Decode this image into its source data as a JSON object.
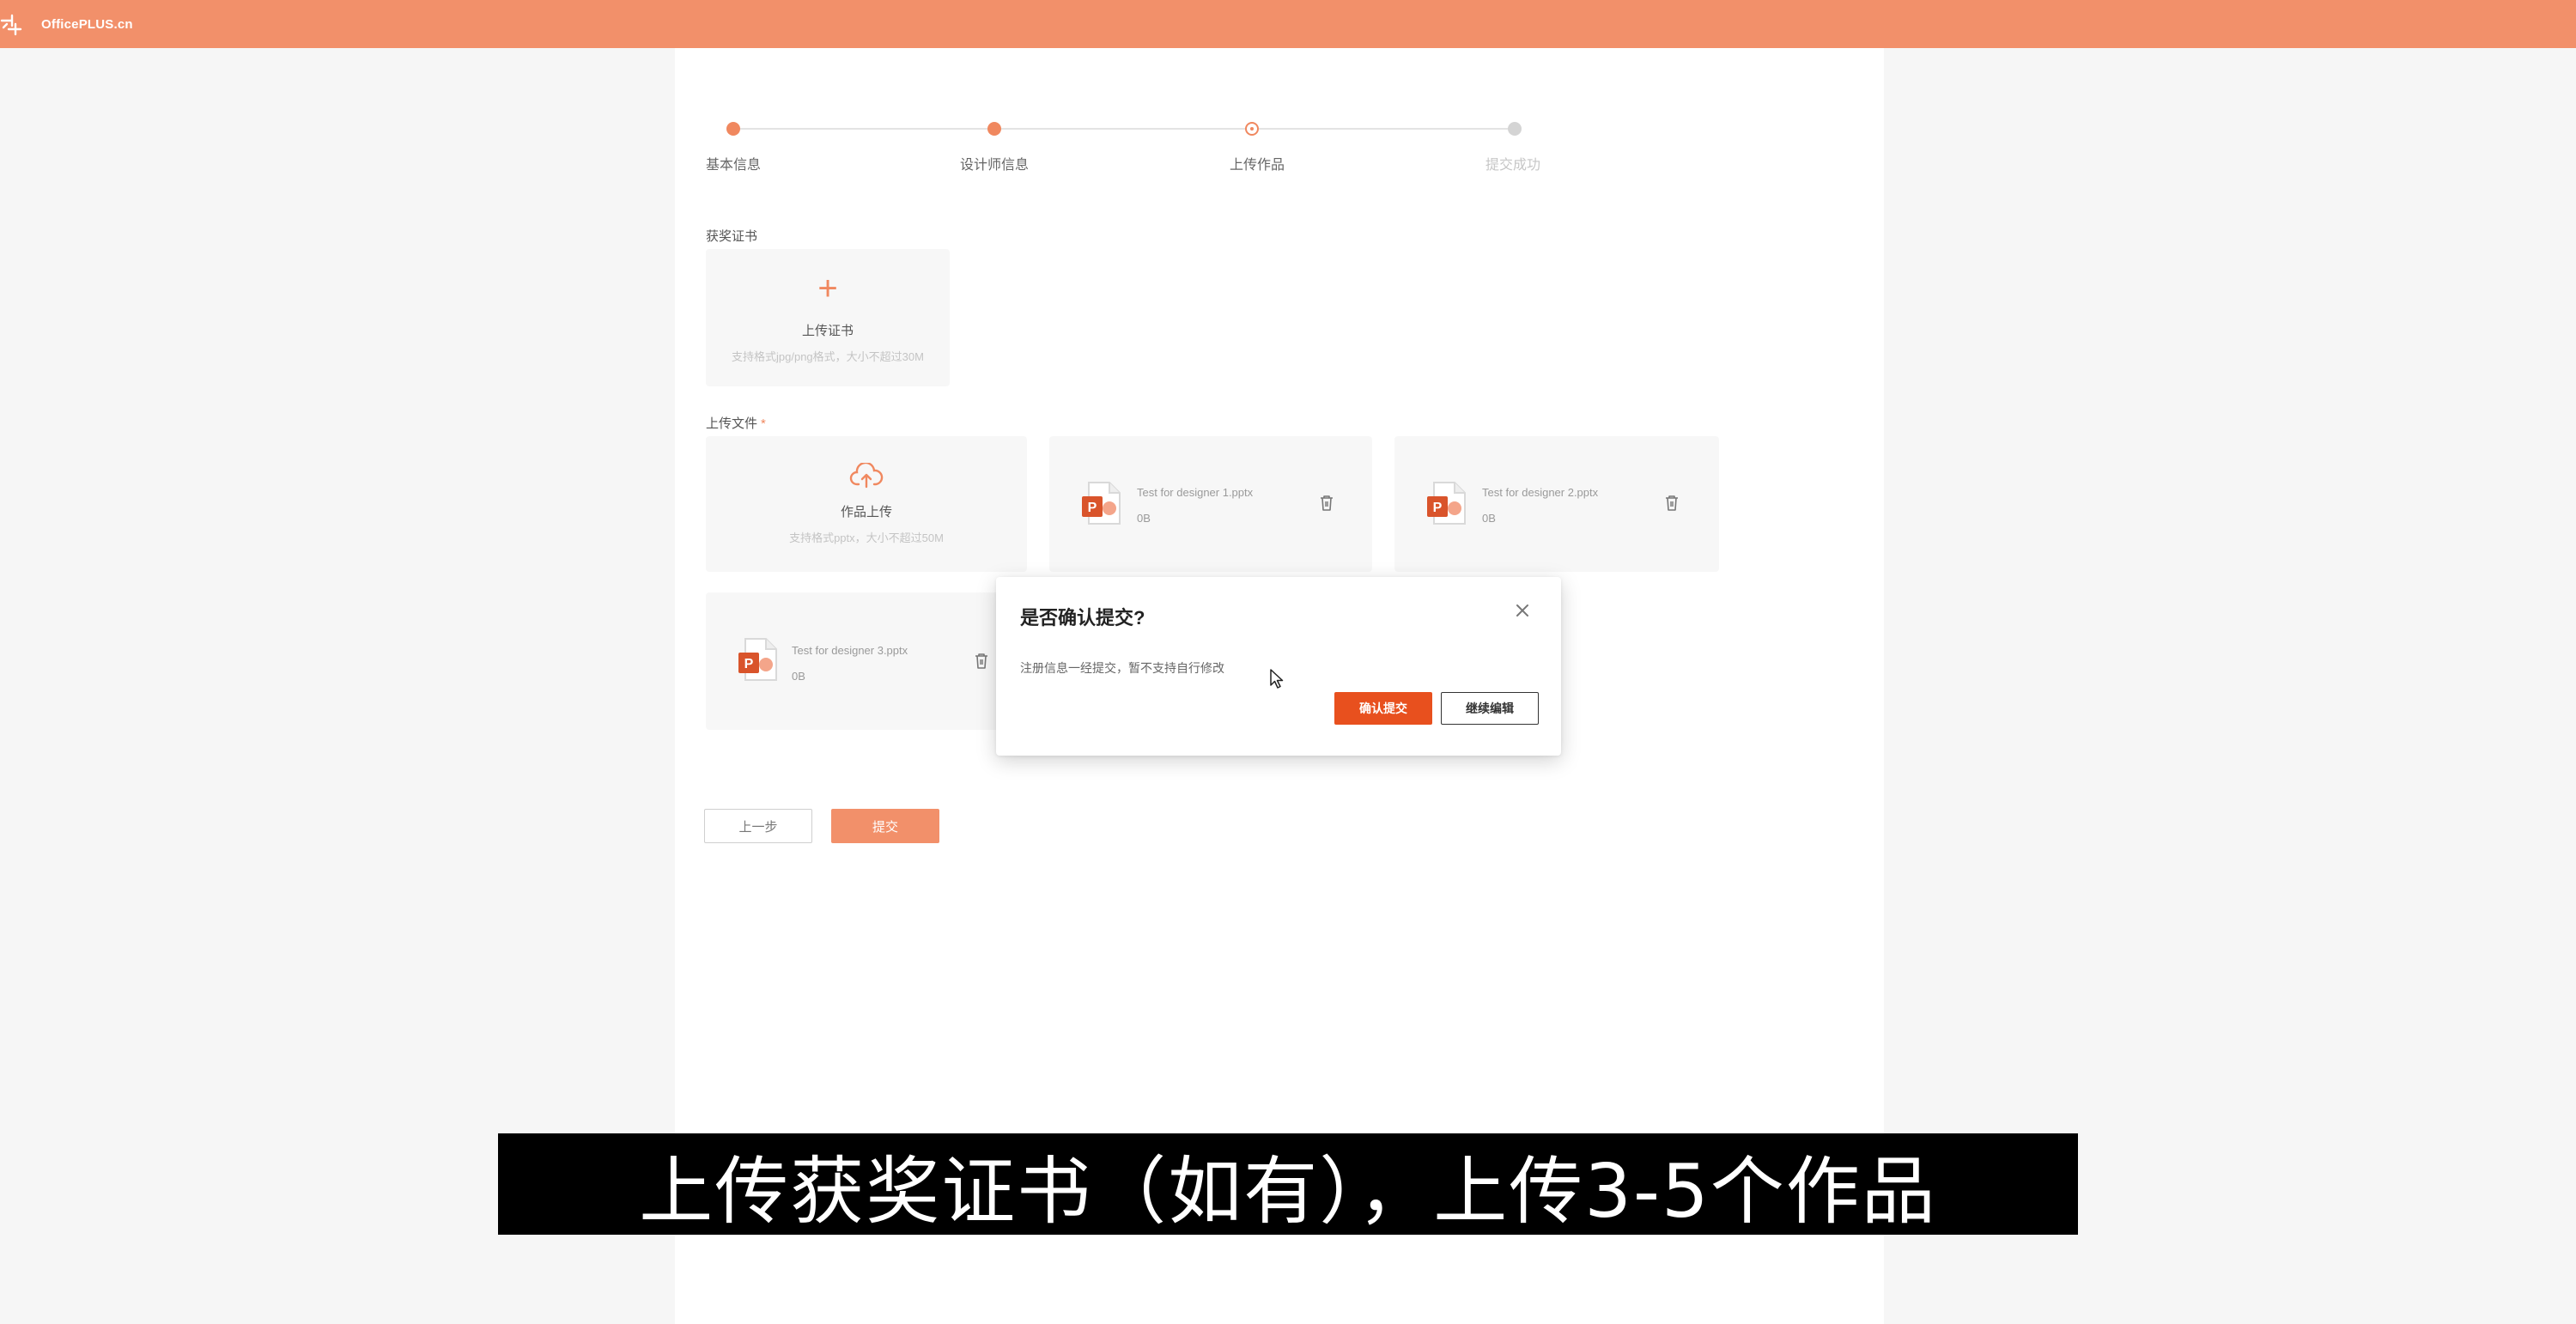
{
  "topbar": {
    "brand_name": "OfficePLUS.cn",
    "brand_color": "#f2906a"
  },
  "stepper": {
    "steps": [
      {
        "label": "基本信息",
        "state": "done"
      },
      {
        "label": "设计师信息",
        "state": "done"
      },
      {
        "label": "上传作品",
        "state": "current"
      },
      {
        "label": "提交成功",
        "state": "todo"
      }
    ]
  },
  "certificate": {
    "section_label": "获奖证书",
    "upload_title": "上传证书",
    "upload_hint": "支持格式jpg/png格式，大小不超过30M"
  },
  "files": {
    "section_label": "上传文件",
    "required_mark": "*",
    "upload_title": "作品上传",
    "upload_hint": "支持格式pptx，大小不超过50M",
    "items": [
      {
        "name": "Test for designer 1.pptx",
        "size": "0B"
      },
      {
        "name": "Test for designer 2.pptx",
        "size": "0B"
      },
      {
        "name": "Test for designer 3.pptx",
        "size": "0B"
      }
    ]
  },
  "actions": {
    "prev_label": "上一步",
    "submit_label": "提交"
  },
  "modal": {
    "title": "是否确认提交?",
    "body": "注册信息一经提交，暂不支持自行修改",
    "confirm_label": "确认提交",
    "continue_label": "继续编辑"
  },
  "caption": {
    "text": "上传获奖证书（如有），上传3-5个作品"
  },
  "colors": {
    "accent": "#f0885f",
    "confirm": "#e8501e"
  }
}
